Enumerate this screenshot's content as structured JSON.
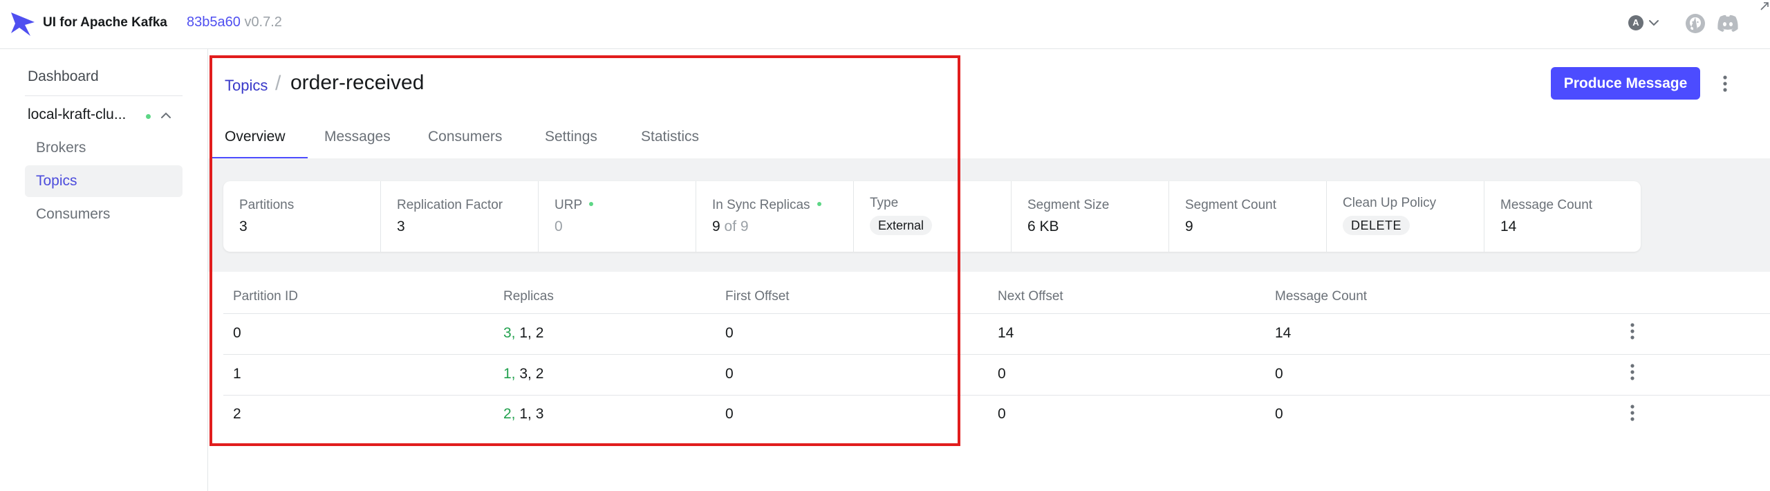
{
  "header": {
    "app_name": "UI for Apache Kafka",
    "version_hash": "83b5a60",
    "version": "v0.7.2",
    "user_initial": "A"
  },
  "sidebar": {
    "dashboard": "Dashboard",
    "cluster": "local-kraft-clu...",
    "items": [
      {
        "label": "Brokers",
        "active": false
      },
      {
        "label": "Topics",
        "active": true
      },
      {
        "label": "Consumers",
        "active": false
      }
    ]
  },
  "breadcrumb": {
    "parent": "Topics",
    "separator": "/",
    "current": "order-received"
  },
  "actions": {
    "produce": "Produce Message"
  },
  "tabs": [
    {
      "label": "Overview",
      "active": true
    },
    {
      "label": "Messages",
      "active": false
    },
    {
      "label": "Consumers",
      "active": false
    },
    {
      "label": "Settings",
      "active": false
    },
    {
      "label": "Statistics",
      "active": false
    }
  ],
  "stats": {
    "partitions": {
      "label": "Partitions",
      "value": "3"
    },
    "replication_factor": {
      "label": "Replication Factor",
      "value": "3"
    },
    "urp": {
      "label": "URP",
      "value": "0"
    },
    "in_sync": {
      "label": "In Sync Replicas",
      "value": "9",
      "of": "of 9"
    },
    "type": {
      "label": "Type",
      "value": "External"
    },
    "segment_size": {
      "label": "Segment Size",
      "value": "6 KB"
    },
    "segment_count": {
      "label": "Segment Count",
      "value": "9"
    },
    "cleanup": {
      "label": "Clean Up Policy",
      "value": "DELETE"
    },
    "message_count": {
      "label": "Message Count",
      "value": "14"
    }
  },
  "table": {
    "columns": [
      "Partition ID",
      "Replicas",
      "First Offset",
      "Next Offset",
      "Message Count"
    ],
    "rows": [
      {
        "id": "0",
        "leader": "3,",
        "replicas": "1, 2",
        "first": "0",
        "next": "14",
        "count": "14"
      },
      {
        "id": "1",
        "leader": "1,",
        "replicas": "3, 2",
        "first": "0",
        "next": "0",
        "count": "0"
      },
      {
        "id": "2",
        "leader": "2,",
        "replicas": "1, 3",
        "first": "0",
        "next": "0",
        "count": "0"
      }
    ]
  },
  "colors": {
    "accent": "#4c4cff",
    "link": "#3939c9",
    "success": "#5cd685",
    "leader": "#22a14e",
    "highlight": "#e11d1d"
  }
}
